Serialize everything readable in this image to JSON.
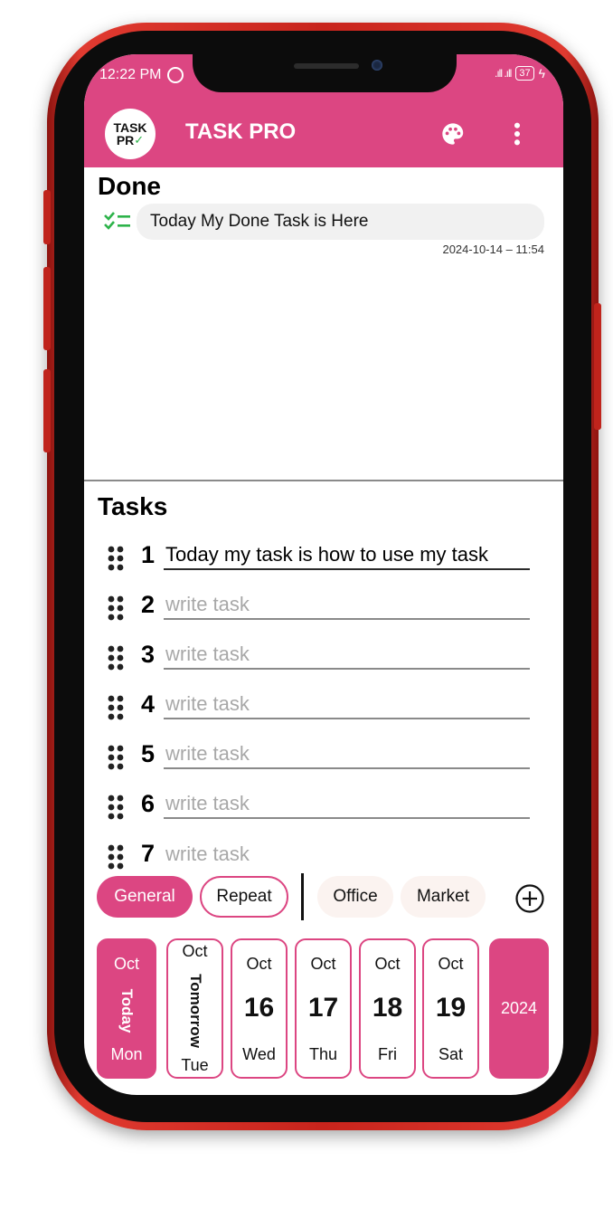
{
  "status_bar": {
    "time": "12:22 PM",
    "battery": "37",
    "signal": ".ıll .ıll"
  },
  "app": {
    "title": "TASK PRO",
    "logo_top": "TASK",
    "logo_bottom": "PR"
  },
  "done": {
    "title": "Done",
    "items": [
      {
        "text": "Today My Done Task is Here",
        "timestamp": "2024-10-14 – 11:54"
      }
    ]
  },
  "tasks": {
    "title": "Tasks",
    "placeholder": "write task",
    "items": [
      {
        "number": "1",
        "value": "Today my task is how to use my task"
      },
      {
        "number": "2",
        "value": ""
      },
      {
        "number": "3",
        "value": ""
      },
      {
        "number": "4",
        "value": ""
      },
      {
        "number": "5",
        "value": ""
      },
      {
        "number": "6",
        "value": ""
      },
      {
        "number": "7",
        "value": ""
      }
    ]
  },
  "categories": {
    "general": "General",
    "repeat": "Repeat",
    "office": "Office",
    "market": "Market"
  },
  "dates": [
    {
      "month": "Oct",
      "label": "Today",
      "dow": "Mon"
    },
    {
      "month": "Oct",
      "label": "Tomorrow",
      "dow": "Tue"
    },
    {
      "month": "Oct",
      "day": "16",
      "dow": "Wed"
    },
    {
      "month": "Oct",
      "day": "17",
      "dow": "Thu"
    },
    {
      "month": "Oct",
      "day": "18",
      "dow": "Fri"
    },
    {
      "month": "Oct",
      "day": "19",
      "dow": "Sat"
    }
  ],
  "year": "2024",
  "colors": {
    "accent": "#dc4682",
    "frame": "#c8241c",
    "done_check": "#2db34a",
    "chip_light": "#fbf3f0"
  },
  "icons": {
    "logo": "task-pro-logo-icon",
    "palette": "palette-icon",
    "menu": "more-vert-icon",
    "done": "checklist-icon",
    "drag": "drag-handle-icon",
    "add": "add-circle-icon"
  }
}
